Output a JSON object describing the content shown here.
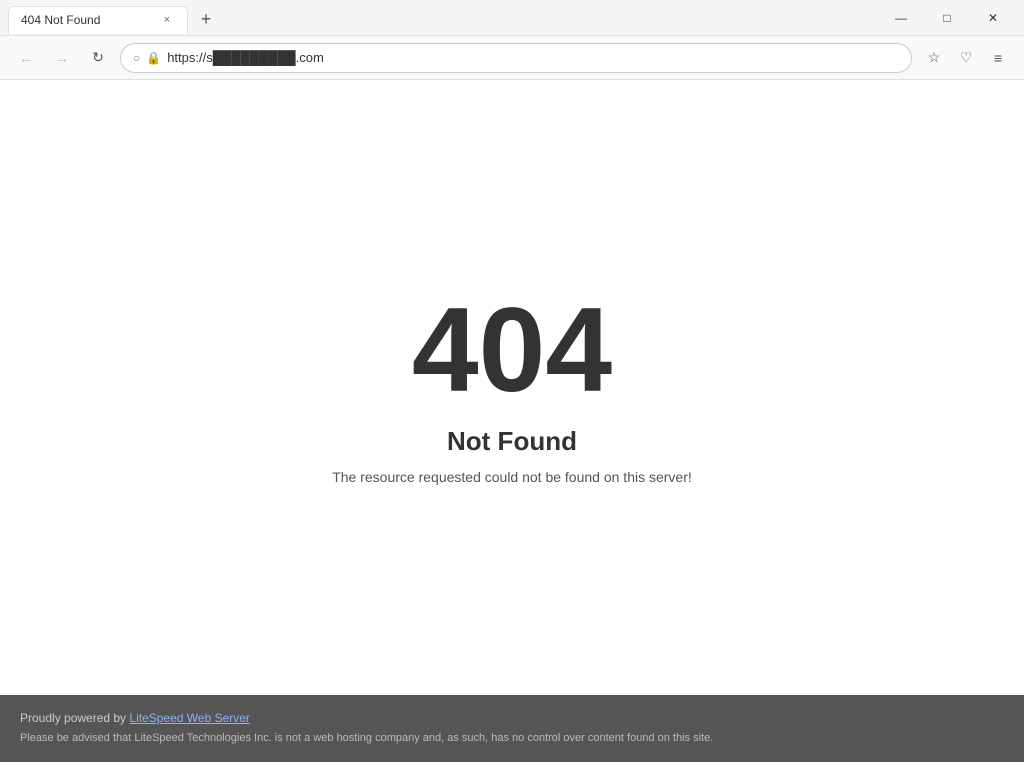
{
  "browser": {
    "tab": {
      "title": "404 Not Found",
      "close_label": "×"
    },
    "new_tab_label": "+",
    "window_controls": {
      "minimize": "—",
      "maximize": "□",
      "close": "✕"
    },
    "nav": {
      "back_icon": "←",
      "forward_icon": "→",
      "refresh_icon": "↻",
      "shield_icon": "○",
      "lock_icon": "🔒",
      "url": "https://s█████████.com",
      "bookmark_icon": "☆",
      "save_icon": "♡",
      "menu_icon": "≡"
    }
  },
  "page": {
    "error_code": "404",
    "error_title": "Not Found",
    "error_desc": "The resource requested could not be found on this server!",
    "footer": {
      "line1_prefix": "Proudly powered by ",
      "link_text": "LiteSpeed Web Server",
      "line2": "Please be advised that LiteSpeed Technologies Inc. is not a web hosting company and, as such, has no control over content found on this site."
    }
  }
}
